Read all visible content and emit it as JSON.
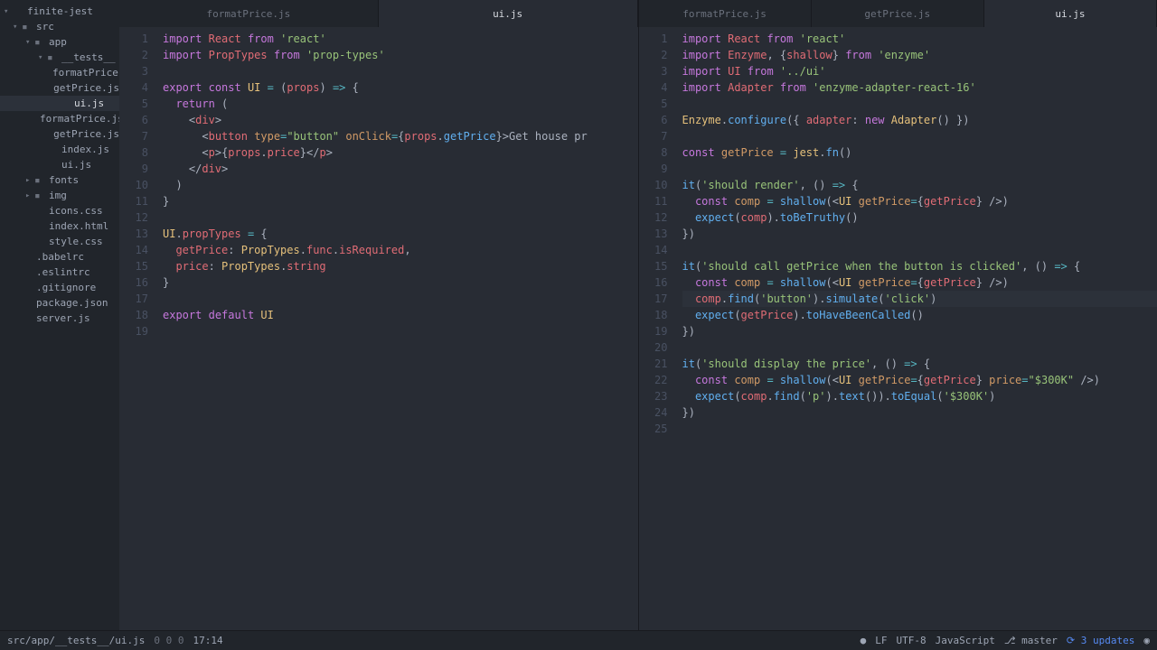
{
  "project": {
    "name": "finite-jest"
  },
  "tree": [
    {
      "label": "finite-jest",
      "indent": 0,
      "exp": true,
      "icon": "chev"
    },
    {
      "label": "src",
      "indent": 1,
      "exp": true,
      "icon": "folder"
    },
    {
      "label": "app",
      "indent": 2,
      "exp": true,
      "icon": "folder"
    },
    {
      "label": "__tests__",
      "indent": 3,
      "exp": true,
      "icon": "folder"
    },
    {
      "label": "formatPrice.js",
      "indent": 4,
      "icon": "file"
    },
    {
      "label": "getPrice.js",
      "indent": 4,
      "icon": "file"
    },
    {
      "label": "ui.js",
      "indent": 4,
      "icon": "file",
      "selected": true
    },
    {
      "label": "formatPrice.js",
      "indent": 3,
      "icon": "file"
    },
    {
      "label": "getPrice.js",
      "indent": 3,
      "icon": "file"
    },
    {
      "label": "index.js",
      "indent": 3,
      "icon": "file"
    },
    {
      "label": "ui.js",
      "indent": 3,
      "icon": "file"
    },
    {
      "label": "fonts",
      "indent": 2,
      "exp": false,
      "icon": "folder"
    },
    {
      "label": "img",
      "indent": 2,
      "exp": false,
      "icon": "folder"
    },
    {
      "label": "icons.css",
      "indent": 2,
      "icon": "file"
    },
    {
      "label": "index.html",
      "indent": 2,
      "icon": "file"
    },
    {
      "label": "style.css",
      "indent": 2,
      "icon": "file"
    },
    {
      "label": ".babelrc",
      "indent": 1,
      "icon": "file"
    },
    {
      "label": ".eslintrc",
      "indent": 1,
      "icon": "file"
    },
    {
      "label": ".gitignore",
      "indent": 1,
      "icon": "file"
    },
    {
      "label": "package.json",
      "indent": 1,
      "icon": "file"
    },
    {
      "label": "server.js",
      "indent": 1,
      "icon": "file"
    }
  ],
  "leftPane": {
    "tabs": [
      {
        "label": "formatPrice.js"
      },
      {
        "label": "ui.js",
        "active": true
      }
    ],
    "lines": 19,
    "code": [
      [
        [
          "kw",
          "import"
        ],
        [
          "txt",
          " "
        ],
        [
          "var",
          "React"
        ],
        [
          "txt",
          " "
        ],
        [
          "kw",
          "from"
        ],
        [
          "txt",
          " "
        ],
        [
          "str",
          "'react'"
        ]
      ],
      [
        [
          "kw",
          "import"
        ],
        [
          "txt",
          " "
        ],
        [
          "var",
          "PropTypes"
        ],
        [
          "txt",
          " "
        ],
        [
          "kw",
          "from"
        ],
        [
          "txt",
          " "
        ],
        [
          "str",
          "'prop-types'"
        ]
      ],
      [],
      [
        [
          "kw",
          "export"
        ],
        [
          "txt",
          " "
        ],
        [
          "kw",
          "const"
        ],
        [
          "txt",
          " "
        ],
        [
          "cls",
          "UI"
        ],
        [
          "txt",
          " "
        ],
        [
          "op",
          "="
        ],
        [
          "txt",
          " "
        ],
        [
          "pun",
          "("
        ],
        [
          "var",
          "props"
        ],
        [
          "pun",
          ")"
        ],
        [
          "txt",
          " "
        ],
        [
          "op",
          "=>"
        ],
        [
          "txt",
          " "
        ],
        [
          "pun",
          "{"
        ]
      ],
      [
        [
          "txt",
          "  "
        ],
        [
          "kw",
          "return"
        ],
        [
          "txt",
          " "
        ],
        [
          "pun",
          "("
        ]
      ],
      [
        [
          "txt",
          "    "
        ],
        [
          "pun",
          "<"
        ],
        [
          "tag",
          "div"
        ],
        [
          "pun",
          ">"
        ]
      ],
      [
        [
          "txt",
          "      "
        ],
        [
          "pun",
          "<"
        ],
        [
          "tag",
          "button"
        ],
        [
          "txt",
          " "
        ],
        [
          "attr",
          "type"
        ],
        [
          "op",
          "="
        ],
        [
          "str",
          "\"button\""
        ],
        [
          "txt",
          " "
        ],
        [
          "attr",
          "onClick"
        ],
        [
          "op",
          "="
        ],
        [
          "pun",
          "{"
        ],
        [
          "var",
          "props"
        ],
        [
          "pun",
          "."
        ],
        [
          "fn",
          "getPrice"
        ],
        [
          "pun",
          "}"
        ],
        [
          "pun",
          ">"
        ],
        [
          "txt",
          "Get house pr"
        ]
      ],
      [
        [
          "txt",
          "      "
        ],
        [
          "pun",
          "<"
        ],
        [
          "tag",
          "p"
        ],
        [
          "pun",
          ">"
        ],
        [
          "pun",
          "{"
        ],
        [
          "var",
          "props"
        ],
        [
          "pun",
          "."
        ],
        [
          "var",
          "price"
        ],
        [
          "pun",
          "}"
        ],
        [
          "pun",
          "</"
        ],
        [
          "tag",
          "p"
        ],
        [
          "pun",
          ">"
        ]
      ],
      [
        [
          "txt",
          "    "
        ],
        [
          "pun",
          "</"
        ],
        [
          "tag",
          "div"
        ],
        [
          "pun",
          ">"
        ]
      ],
      [
        [
          "txt",
          "  "
        ],
        [
          "pun",
          ")"
        ]
      ],
      [
        [
          "pun",
          "}"
        ]
      ],
      [],
      [
        [
          "cls",
          "UI"
        ],
        [
          "pun",
          "."
        ],
        [
          "var",
          "propTypes"
        ],
        [
          "txt",
          " "
        ],
        [
          "op",
          "="
        ],
        [
          "txt",
          " "
        ],
        [
          "pun",
          "{"
        ]
      ],
      [
        [
          "txt",
          "  "
        ],
        [
          "var",
          "getPrice"
        ],
        [
          "pun",
          ": "
        ],
        [
          "cls",
          "PropTypes"
        ],
        [
          "pun",
          "."
        ],
        [
          "var",
          "func"
        ],
        [
          "pun",
          "."
        ],
        [
          "var",
          "isRequired"
        ],
        [
          "pun",
          ","
        ]
      ],
      [
        [
          "txt",
          "  "
        ],
        [
          "var",
          "price"
        ],
        [
          "pun",
          ": "
        ],
        [
          "cls",
          "PropTypes"
        ],
        [
          "pun",
          "."
        ],
        [
          "var",
          "string"
        ]
      ],
      [
        [
          "pun",
          "}"
        ]
      ],
      [],
      [
        [
          "kw",
          "export"
        ],
        [
          "txt",
          " "
        ],
        [
          "kw",
          "default"
        ],
        [
          "txt",
          " "
        ],
        [
          "cls",
          "UI"
        ]
      ],
      []
    ]
  },
  "rightPane": {
    "tabs": [
      {
        "label": "formatPrice.js"
      },
      {
        "label": "getPrice.js"
      },
      {
        "label": "ui.js",
        "active": true
      }
    ],
    "lines": 25,
    "highlight": 17,
    "code": [
      [
        [
          "kw",
          "import"
        ],
        [
          "txt",
          " "
        ],
        [
          "var",
          "React"
        ],
        [
          "txt",
          " "
        ],
        [
          "kw",
          "from"
        ],
        [
          "txt",
          " "
        ],
        [
          "str",
          "'react'"
        ]
      ],
      [
        [
          "kw",
          "import"
        ],
        [
          "txt",
          " "
        ],
        [
          "var",
          "Enzyme"
        ],
        [
          "pun",
          ", "
        ],
        [
          "pun",
          "{"
        ],
        [
          "var",
          "shallow"
        ],
        [
          "pun",
          "}"
        ],
        [
          "txt",
          " "
        ],
        [
          "kw",
          "from"
        ],
        [
          "txt",
          " "
        ],
        [
          "str",
          "'enzyme'"
        ]
      ],
      [
        [
          "kw",
          "import"
        ],
        [
          "txt",
          " "
        ],
        [
          "var",
          "UI"
        ],
        [
          "txt",
          " "
        ],
        [
          "kw",
          "from"
        ],
        [
          "txt",
          " "
        ],
        [
          "str",
          "'../ui'"
        ]
      ],
      [
        [
          "kw",
          "import"
        ],
        [
          "txt",
          " "
        ],
        [
          "var",
          "Adapter"
        ],
        [
          "txt",
          " "
        ],
        [
          "kw",
          "from"
        ],
        [
          "txt",
          " "
        ],
        [
          "str",
          "'enzyme-adapter-react-16'"
        ]
      ],
      [],
      [
        [
          "cls",
          "Enzyme"
        ],
        [
          "pun",
          "."
        ],
        [
          "fn",
          "configure"
        ],
        [
          "pun",
          "({ "
        ],
        [
          "var",
          "adapter"
        ],
        [
          "pun",
          ": "
        ],
        [
          "kw",
          "new"
        ],
        [
          "txt",
          " "
        ],
        [
          "cls",
          "Adapter"
        ],
        [
          "pun",
          "() })"
        ]
      ],
      [],
      [
        [
          "kw",
          "const"
        ],
        [
          "txt",
          " "
        ],
        [
          "cst",
          "getPrice"
        ],
        [
          "txt",
          " "
        ],
        [
          "op",
          "="
        ],
        [
          "txt",
          " "
        ],
        [
          "cls",
          "jest"
        ],
        [
          "pun",
          "."
        ],
        [
          "fn",
          "fn"
        ],
        [
          "pun",
          "()"
        ]
      ],
      [],
      [
        [
          "fn",
          "it"
        ],
        [
          "pun",
          "("
        ],
        [
          "str",
          "'should render'"
        ],
        [
          "pun",
          ", () "
        ],
        [
          "op",
          "=>"
        ],
        [
          "txt",
          " "
        ],
        [
          "pun",
          "{"
        ]
      ],
      [
        [
          "txt",
          "  "
        ],
        [
          "kw",
          "const"
        ],
        [
          "txt",
          " "
        ],
        [
          "cst",
          "comp"
        ],
        [
          "txt",
          " "
        ],
        [
          "op",
          "="
        ],
        [
          "txt",
          " "
        ],
        [
          "fn",
          "shallow"
        ],
        [
          "pun",
          "(<"
        ],
        [
          "cls",
          "UI"
        ],
        [
          "txt",
          " "
        ],
        [
          "attr",
          "getPrice"
        ],
        [
          "op",
          "="
        ],
        [
          "pun",
          "{"
        ],
        [
          "var",
          "getPrice"
        ],
        [
          "pun",
          "} />)"
        ]
      ],
      [
        [
          "txt",
          "  "
        ],
        [
          "fn",
          "expect"
        ],
        [
          "pun",
          "("
        ],
        [
          "var",
          "comp"
        ],
        [
          "pun",
          ")."
        ],
        [
          "fn",
          "toBeTruthy"
        ],
        [
          "pun",
          "()"
        ]
      ],
      [
        [
          "pun",
          "})"
        ]
      ],
      [],
      [
        [
          "fn",
          "it"
        ],
        [
          "pun",
          "("
        ],
        [
          "str",
          "'should call getPrice when the button is clicked'"
        ],
        [
          "pun",
          ", () "
        ],
        [
          "op",
          "=>"
        ],
        [
          "txt",
          " "
        ],
        [
          "pun",
          "{"
        ]
      ],
      [
        [
          "txt",
          "  "
        ],
        [
          "kw",
          "const"
        ],
        [
          "txt",
          " "
        ],
        [
          "cst",
          "comp"
        ],
        [
          "txt",
          " "
        ],
        [
          "op",
          "="
        ],
        [
          "txt",
          " "
        ],
        [
          "fn",
          "shallow"
        ],
        [
          "pun",
          "(<"
        ],
        [
          "cls",
          "UI"
        ],
        [
          "txt",
          " "
        ],
        [
          "attr",
          "getPrice"
        ],
        [
          "op",
          "="
        ],
        [
          "pun",
          "{"
        ],
        [
          "var",
          "getPrice"
        ],
        [
          "pun",
          "} />)"
        ]
      ],
      [
        [
          "txt",
          "  "
        ],
        [
          "var",
          "comp"
        ],
        [
          "pun",
          "."
        ],
        [
          "fn",
          "find"
        ],
        [
          "pun",
          "("
        ],
        [
          "str",
          "'button'"
        ],
        [
          "pun",
          ")."
        ],
        [
          "fn",
          "simulate"
        ],
        [
          "pun",
          "("
        ],
        [
          "str",
          "'click'"
        ],
        [
          "pun",
          ")"
        ]
      ],
      [
        [
          "txt",
          "  "
        ],
        [
          "fn",
          "expect"
        ],
        [
          "pun",
          "("
        ],
        [
          "var",
          "getPrice"
        ],
        [
          "pun",
          ")."
        ],
        [
          "fn",
          "toHaveBeenCalled"
        ],
        [
          "pun",
          "()"
        ]
      ],
      [
        [
          "pun",
          "})"
        ]
      ],
      [],
      [
        [
          "fn",
          "it"
        ],
        [
          "pun",
          "("
        ],
        [
          "str",
          "'should display the price'"
        ],
        [
          "pun",
          ", () "
        ],
        [
          "op",
          "=>"
        ],
        [
          "txt",
          " "
        ],
        [
          "pun",
          "{"
        ]
      ],
      [
        [
          "txt",
          "  "
        ],
        [
          "kw",
          "const"
        ],
        [
          "txt",
          " "
        ],
        [
          "cst",
          "comp"
        ],
        [
          "txt",
          " "
        ],
        [
          "op",
          "="
        ],
        [
          "txt",
          " "
        ],
        [
          "fn",
          "shallow"
        ],
        [
          "pun",
          "(<"
        ],
        [
          "cls",
          "UI"
        ],
        [
          "txt",
          " "
        ],
        [
          "attr",
          "getPrice"
        ],
        [
          "op",
          "="
        ],
        [
          "pun",
          "{"
        ],
        [
          "var",
          "getPrice"
        ],
        [
          "pun",
          "} "
        ],
        [
          "attr",
          "price"
        ],
        [
          "op",
          "="
        ],
        [
          "str",
          "\"$300K\""
        ],
        [
          "pun",
          " />)"
        ]
      ],
      [
        [
          "txt",
          "  "
        ],
        [
          "fn",
          "expect"
        ],
        [
          "pun",
          "("
        ],
        [
          "var",
          "comp"
        ],
        [
          "pun",
          "."
        ],
        [
          "fn",
          "find"
        ],
        [
          "pun",
          "("
        ],
        [
          "str",
          "'p'"
        ],
        [
          "pun",
          ")."
        ],
        [
          "fn",
          "text"
        ],
        [
          "pun",
          "())."
        ],
        [
          "fn",
          "toEqual"
        ],
        [
          "pun",
          "("
        ],
        [
          "str",
          "'$300K'"
        ],
        [
          "pun",
          ")"
        ]
      ],
      [
        [
          "pun",
          "})"
        ]
      ],
      []
    ]
  },
  "status": {
    "path": "src/app/__tests__/ui.js",
    "diag": "0   0   0",
    "cursor": "17:14",
    "lf": "LF",
    "encoding": "UTF-8",
    "lang": "JavaScript",
    "branch": "master",
    "updates": "3 updates"
  }
}
